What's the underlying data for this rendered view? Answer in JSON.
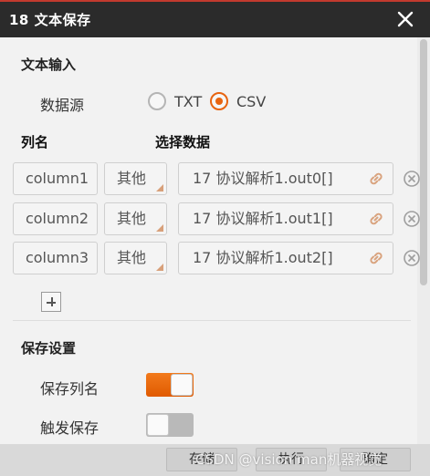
{
  "dialog": {
    "title": "18 文本保存"
  },
  "text_input": {
    "section_title": "文本输入",
    "source_label": "数据源",
    "options": [
      {
        "label": "TXT",
        "checked": false
      },
      {
        "label": "CSV",
        "checked": true
      }
    ]
  },
  "columns": {
    "name_header": "列名",
    "data_header": "选择数据",
    "rows": [
      {
        "name": "column1",
        "type": "其他",
        "data": "17 协议解析1.out0[]"
      },
      {
        "name": "column2",
        "type": "其他",
        "data": "17 协议解析1.out1[]"
      },
      {
        "name": "column3",
        "type": "其他",
        "data": "17 协议解析1.out2[]"
      }
    ]
  },
  "save_settings": {
    "section_title": "保存设置",
    "save_column_names_label": "保存列名",
    "save_column_names_on": true,
    "trigger_save_label": "触发保存",
    "trigger_save_on": false
  },
  "footer": {
    "btn_save_file": "存储",
    "btn_exec": "执行",
    "btn_confirm": "确定"
  },
  "watermark": "CSDN @vision man机器视觉",
  "colors": {
    "accent": "#e86410",
    "titlebar": "#2b2b2b"
  }
}
